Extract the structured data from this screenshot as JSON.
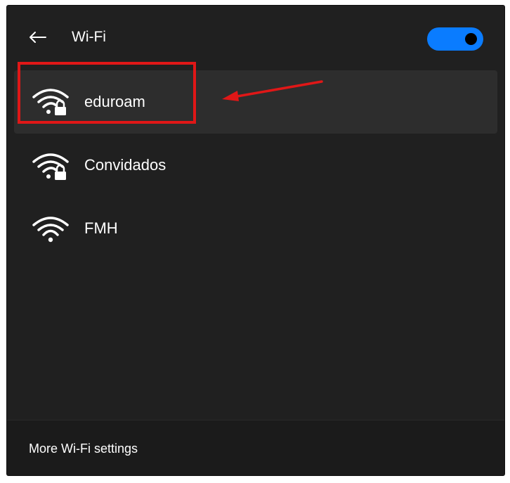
{
  "header": {
    "back_icon": "back-arrow-icon",
    "title": "Wi-Fi",
    "toggle": {
      "state": "on",
      "color": "#0a7cff"
    }
  },
  "networks": [
    {
      "name": "eduroam",
      "icon": "wifi-secured-icon",
      "selected": true
    },
    {
      "name": "Convidados",
      "icon": "wifi-secured-icon",
      "selected": false
    },
    {
      "name": "FMH",
      "icon": "wifi-icon",
      "selected": false
    }
  ],
  "annotation": {
    "color": "#e01717"
  },
  "footer": {
    "link": "More Wi-Fi settings"
  }
}
